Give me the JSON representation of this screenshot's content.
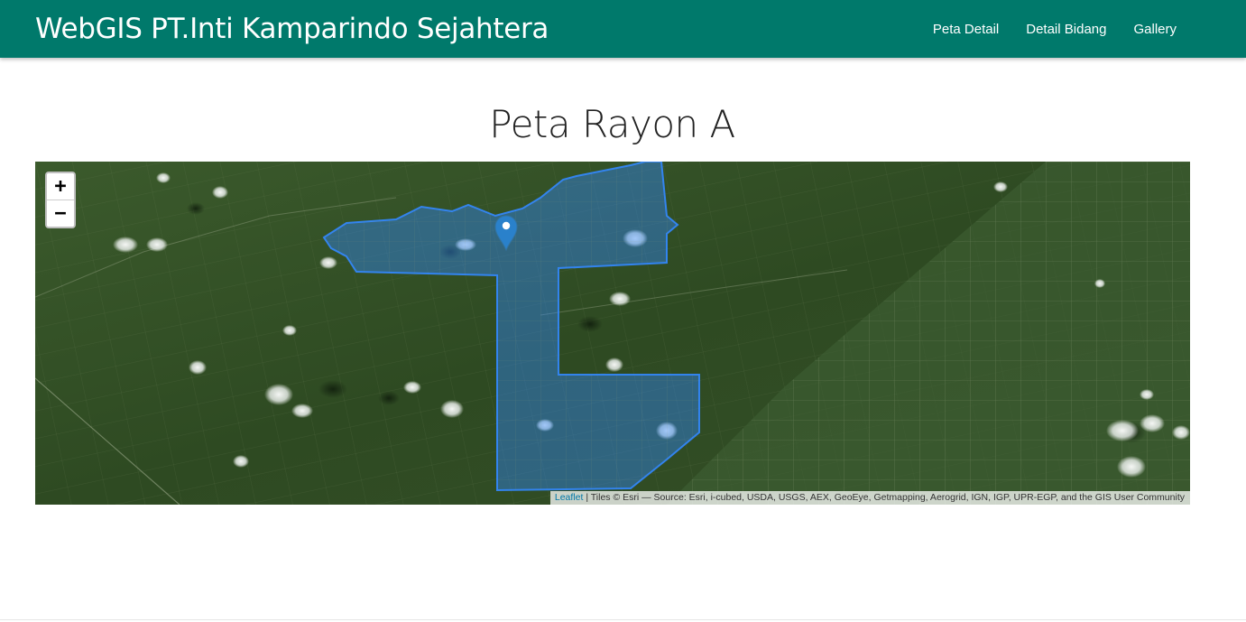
{
  "header": {
    "brand": "WebGIS PT.Inti Kamparindo Sejahtera",
    "nav": [
      {
        "label": "Peta Detail"
      },
      {
        "label": "Detail Bidang"
      },
      {
        "label": "Gallery"
      }
    ],
    "color": "#00796b"
  },
  "page": {
    "title": "Peta Rayon A"
  },
  "map": {
    "basemap": "satellite imagery",
    "polygon_color": "#3388ff",
    "marker_icon": "map-pin-icon",
    "zoom_in": "+",
    "zoom_out": "−",
    "attribution": {
      "leaflet": "Leaflet",
      "separator": " | ",
      "text": "Tiles © Esri — Source: Esri, i-cubed, USDA, USGS, AEX, GeoEye, Getmapping, Aerogrid, IGN, IGP, UPR-EGP, and the GIS User Community"
    }
  }
}
